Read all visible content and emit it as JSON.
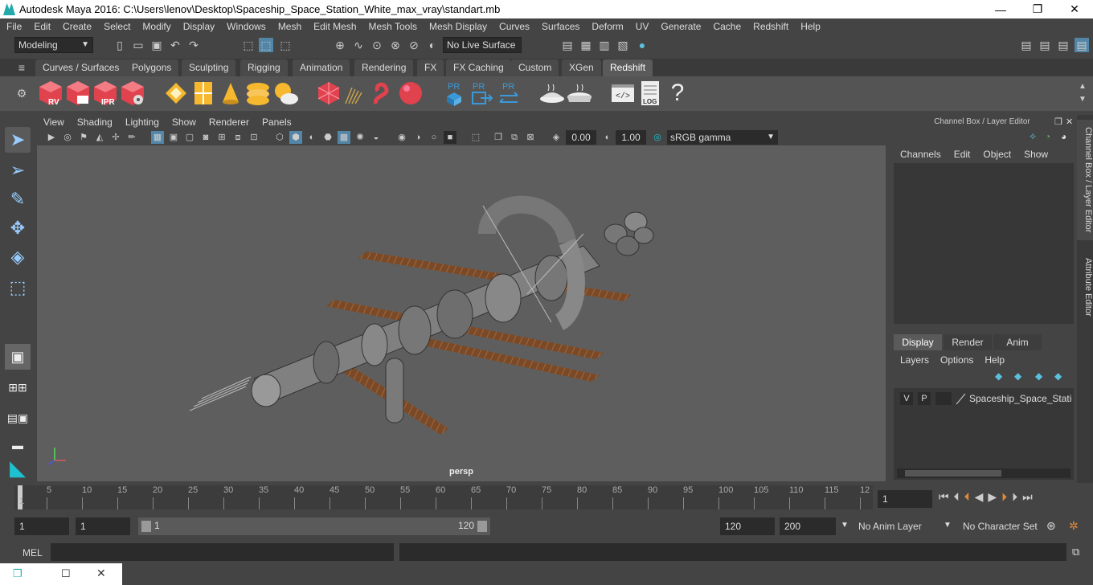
{
  "window": {
    "title": "Autodesk Maya 2016: C:\\Users\\lenov\\Desktop\\Spaceship_Space_Station_White_max_vray\\standart.mb",
    "minimize": "—",
    "maximize": "❐",
    "close": "✕"
  },
  "menus": [
    "File",
    "Edit",
    "Create",
    "Select",
    "Modify",
    "Display",
    "Windows",
    "Mesh",
    "Edit Mesh",
    "Mesh Tools",
    "Mesh Display",
    "Curves",
    "Surfaces",
    "Deform",
    "UV",
    "Generate",
    "Cache",
    "Redshift",
    "Help"
  ],
  "status": {
    "mode": "Modeling",
    "live_surface": "No Live Surface"
  },
  "shelf_tabs": [
    "Curves / Surfaces",
    "Polygons",
    "Sculpting",
    "Rigging",
    "Animation",
    "Rendering",
    "FX",
    "FX Caching",
    "Custom",
    "XGen",
    "Redshift"
  ],
  "shelf_active_tab": "Redshift",
  "shelf_icons": {
    "rv": "RV",
    "ipr": "IPR",
    "pr": "PR",
    "log": "LOG",
    "help": "?"
  },
  "panel_menu": [
    "View",
    "Shading",
    "Lighting",
    "Show",
    "Renderer",
    "Panels"
  ],
  "panel_fields": {
    "exposure": "0.00",
    "gamma": "1.00",
    "color_space": "sRGB gamma"
  },
  "viewport": {
    "camera_label": "persp"
  },
  "channel_box": {
    "title": "Channel Box / Layer Editor",
    "menu": [
      "Channels",
      "Edit",
      "Object",
      "Show"
    ],
    "layer_tabs": [
      "Display",
      "Render",
      "Anim"
    ],
    "layer_active_tab": "Display",
    "layer_menu": [
      "Layers",
      "Options",
      "Help"
    ],
    "layer": {
      "v": "V",
      "p": "P",
      "name": "Spaceship_Space_Station"
    }
  },
  "side_tabs": [
    "Channel Box / Layer Editor",
    "Attribute Editor"
  ],
  "timeline": {
    "ticks": [
      "5",
      "10",
      "15",
      "20",
      "25",
      "30",
      "35",
      "40",
      "45",
      "50",
      "55",
      "60",
      "65",
      "70",
      "75",
      "80",
      "85",
      "90",
      "95",
      "100",
      "105",
      "110",
      "115",
      "12"
    ],
    "start_tick": "1",
    "current_frame": "1"
  },
  "range": {
    "start": "1",
    "start2": "1",
    "range_start": "1",
    "range_end": "120",
    "end": "120",
    "end2": "200",
    "anim_layer": "No Anim Layer",
    "character_set": "No Character Set"
  },
  "cmdline": {
    "label": "MEL"
  },
  "colors": {
    "accent": "#5a5a5a",
    "redshift_red": "#e0424e",
    "pr_blue": "#3a9ad9"
  }
}
